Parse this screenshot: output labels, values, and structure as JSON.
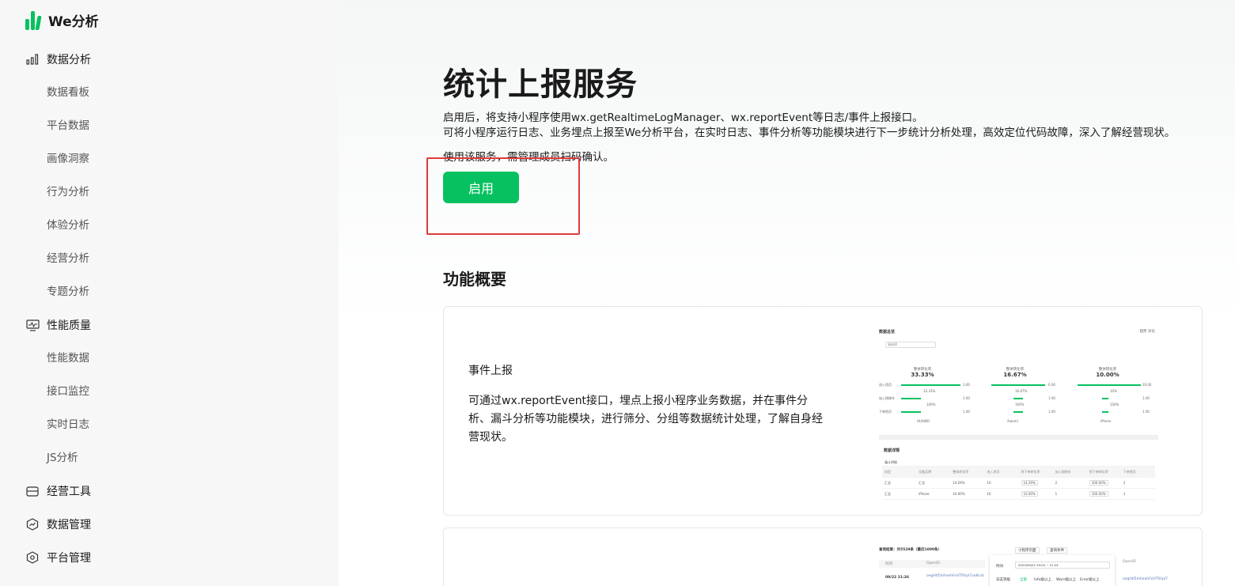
{
  "app": {
    "logo_text": "We分析",
    "brand_color": "#07c160"
  },
  "sidebar": {
    "groups": [
      {
        "label": "数据分析",
        "icon": "bar-chart-icon"
      },
      {
        "label": "性能质量",
        "icon": "monitor-icon"
      },
      {
        "label": "经营工具",
        "icon": "store-icon"
      },
      {
        "label": "数据管理",
        "icon": "hexagon-chart-icon"
      },
      {
        "label": "平台管理",
        "icon": "hexagon-gear-icon"
      }
    ],
    "data_items": [
      "数据看板",
      "平台数据",
      "画像洞察",
      "行为分析",
      "体验分析",
      "经营分析",
      "专题分析"
    ],
    "perf_items": [
      "性能数据",
      "接口监控",
      "实时日志",
      "JS分析"
    ]
  },
  "main": {
    "title": "统计上报服务",
    "desc_line1": "启用后，将支持小程序使用wx.getRealtimeLogManager、wx.reportEvent等日志/事件上报接口。",
    "desc_line2": "可将小程序运行日志、业务埋点上报至We分析平台，在实时日志、事件分析等功能模块进行下一步统计分析处理，高效定位代码故障，深入了解经营现状。",
    "desc_line3": "使用该服务，需管理成员扫码确认。",
    "enable_button": "启用",
    "section_title": "功能概要",
    "feature1": {
      "title": "事件上报",
      "desc": "可通过wx.reportEvent接口，埋点上报小程序业务数据，并在事件分析、漏斗分析等功能模块，进行筛分、分组等数据统计处理，了解自身经营现状。"
    }
  },
  "thumb1": {
    "title": "数据总览",
    "tabs": "趋势   对比",
    "select": "请选择",
    "columns": [
      {
        "label": "整体转化率",
        "value": "33.33%",
        "name": "HUAWEI"
      },
      {
        "label": "整体转化率",
        "value": "16.67%",
        "name": "Xiaomi"
      },
      {
        "label": "整体转化率",
        "value": "10.00%",
        "name": "iPhone"
      }
    ],
    "row_labels": [
      "进入首页",
      "加入购物车",
      "下单首页"
    ],
    "pcts": [
      "33.33%",
      "16.67%",
      "10%"
    ],
    "nums": [
      "3.00",
      "1.00",
      "1.00",
      "6.00",
      "1.00",
      "1.00",
      "10.00",
      "1.00",
      "1.00"
    ],
    "small_pct": "100%",
    "table_title": "数据详情",
    "table_sub": "漏斗明细",
    "table_head": [
      "机型",
      "设备品牌",
      "整体转化率",
      "进入首页",
      "到下单转化率",
      "加入购物车",
      "到下单转化率",
      "下单首页"
    ],
    "table_rows": [
      [
        "汇总",
        "汇总",
        "14.29%",
        "14",
        "14.29%",
        "2",
        "100.00%",
        "2"
      ],
      [
        "汇总",
        "iPhone",
        "10.00%",
        "10",
        "10.00%",
        "1",
        "100.00%",
        "1"
      ]
    ]
  },
  "thumb2": {
    "title": "查询结果：共5529条（最近1000条）",
    "col_time": "时间",
    "col_openid": "OpenID",
    "tab1": "小程序页面",
    "tab2": "查询条件",
    "time_val": "09/22 21:26",
    "openid_val": "oegHtl5mhexhFoVTRhpl7oo8cdc",
    "label_time": "时间",
    "label_filter": "日志等级",
    "range_val": "2023/09/22 19:04 ~ 21:24",
    "lv1": "全部",
    "lv2": "Info级以上",
    "lv3": "Warn级以上",
    "lv4": "Error级以上",
    "right_head": "OpenID",
    "right_val": "oegHtl5mhexhFoVTRhpl7"
  }
}
